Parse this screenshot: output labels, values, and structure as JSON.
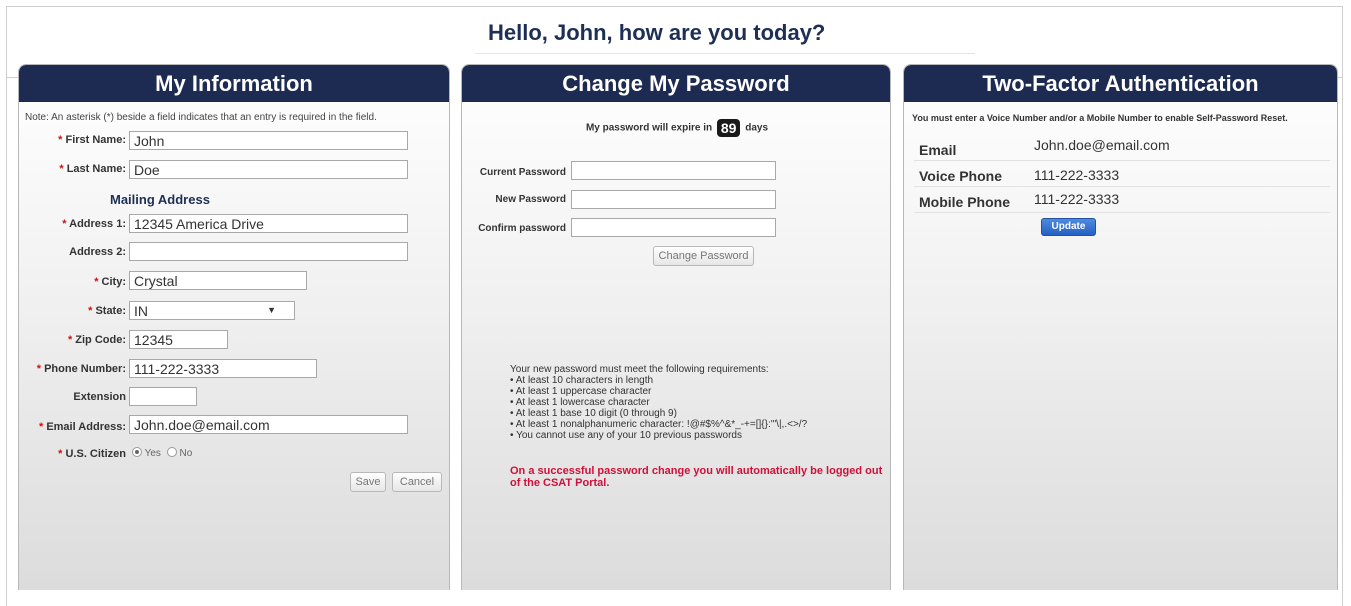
{
  "greeting": "Hello, John, how are you today?",
  "my_info": {
    "title": "My Information",
    "note": "Note: An asterisk (*) beside a field indicates that an entry is required in the field.",
    "required_mark": "*",
    "first_name_label": "First Name:",
    "first_name_value": "John",
    "last_name_label": "Last Name:",
    "last_name_value": "Doe",
    "mailing_address_heading": "Mailing Address",
    "address1_label": "Address 1:",
    "address1_value": "12345 America Drive",
    "address2_label": "Address 2:",
    "address2_value": "",
    "city_label": "City:",
    "city_value": "Crystal",
    "state_label": "State:",
    "state_value": "IN",
    "zip_label": "Zip Code:",
    "zip_value": "12345",
    "phone_label": "Phone Number:",
    "phone_value": "111-222-3333",
    "extension_label": "Extension",
    "extension_value": "",
    "email_label": "Email Address:",
    "email_value": "John.doe@email.com",
    "citizen_label": "U.S. Citizen",
    "citizen_yes": "Yes",
    "citizen_no": "No",
    "save_label": "Save",
    "cancel_label": "Cancel"
  },
  "change_pwd": {
    "title": "Change My Password",
    "expire_prefix": "My password will expire in",
    "expire_days": "89",
    "expire_suffix": "days",
    "current_label": "Current Password",
    "new_label": "New Password",
    "confirm_label": "Confirm password",
    "button_label": "Change Password",
    "requirements_intro": "Your new password must meet the following requirements:",
    "requirements": [
      "• At least 10 characters in length",
      "• At least 1 uppercase character",
      "• At least 1 lowercase character",
      "• At least 1 base 10 digit (0 through 9)",
      "• At least 1 nonalphanumeric character: !@#$%^&*_-+=[]{}:'\"\\|,.<>/?",
      "• You cannot use any of your 10 previous passwords"
    ],
    "warning": "On a successful password change you will automatically be logged out of the CSAT Portal."
  },
  "two_factor": {
    "title": "Two-Factor Authentication",
    "note": "You must enter a Voice Number and/or a Mobile Number to enable Self-Password Reset.",
    "email_label": "Email",
    "email_value": "John.doe@email.com",
    "voice_label": "Voice Phone",
    "voice_value": "111-222-3333",
    "mobile_label": "Mobile Phone",
    "mobile_value": "111-222-3333",
    "update_label": "Update"
  },
  "colors": {
    "header_bg": "#1d2a52",
    "greeting_text": "#1e2f56",
    "required_star": "#cc1111",
    "warning_text": "#d0103a",
    "update_button": "#2f6bcd"
  },
  "icons": {
    "state_dropdown": "chevron-down-icon"
  }
}
